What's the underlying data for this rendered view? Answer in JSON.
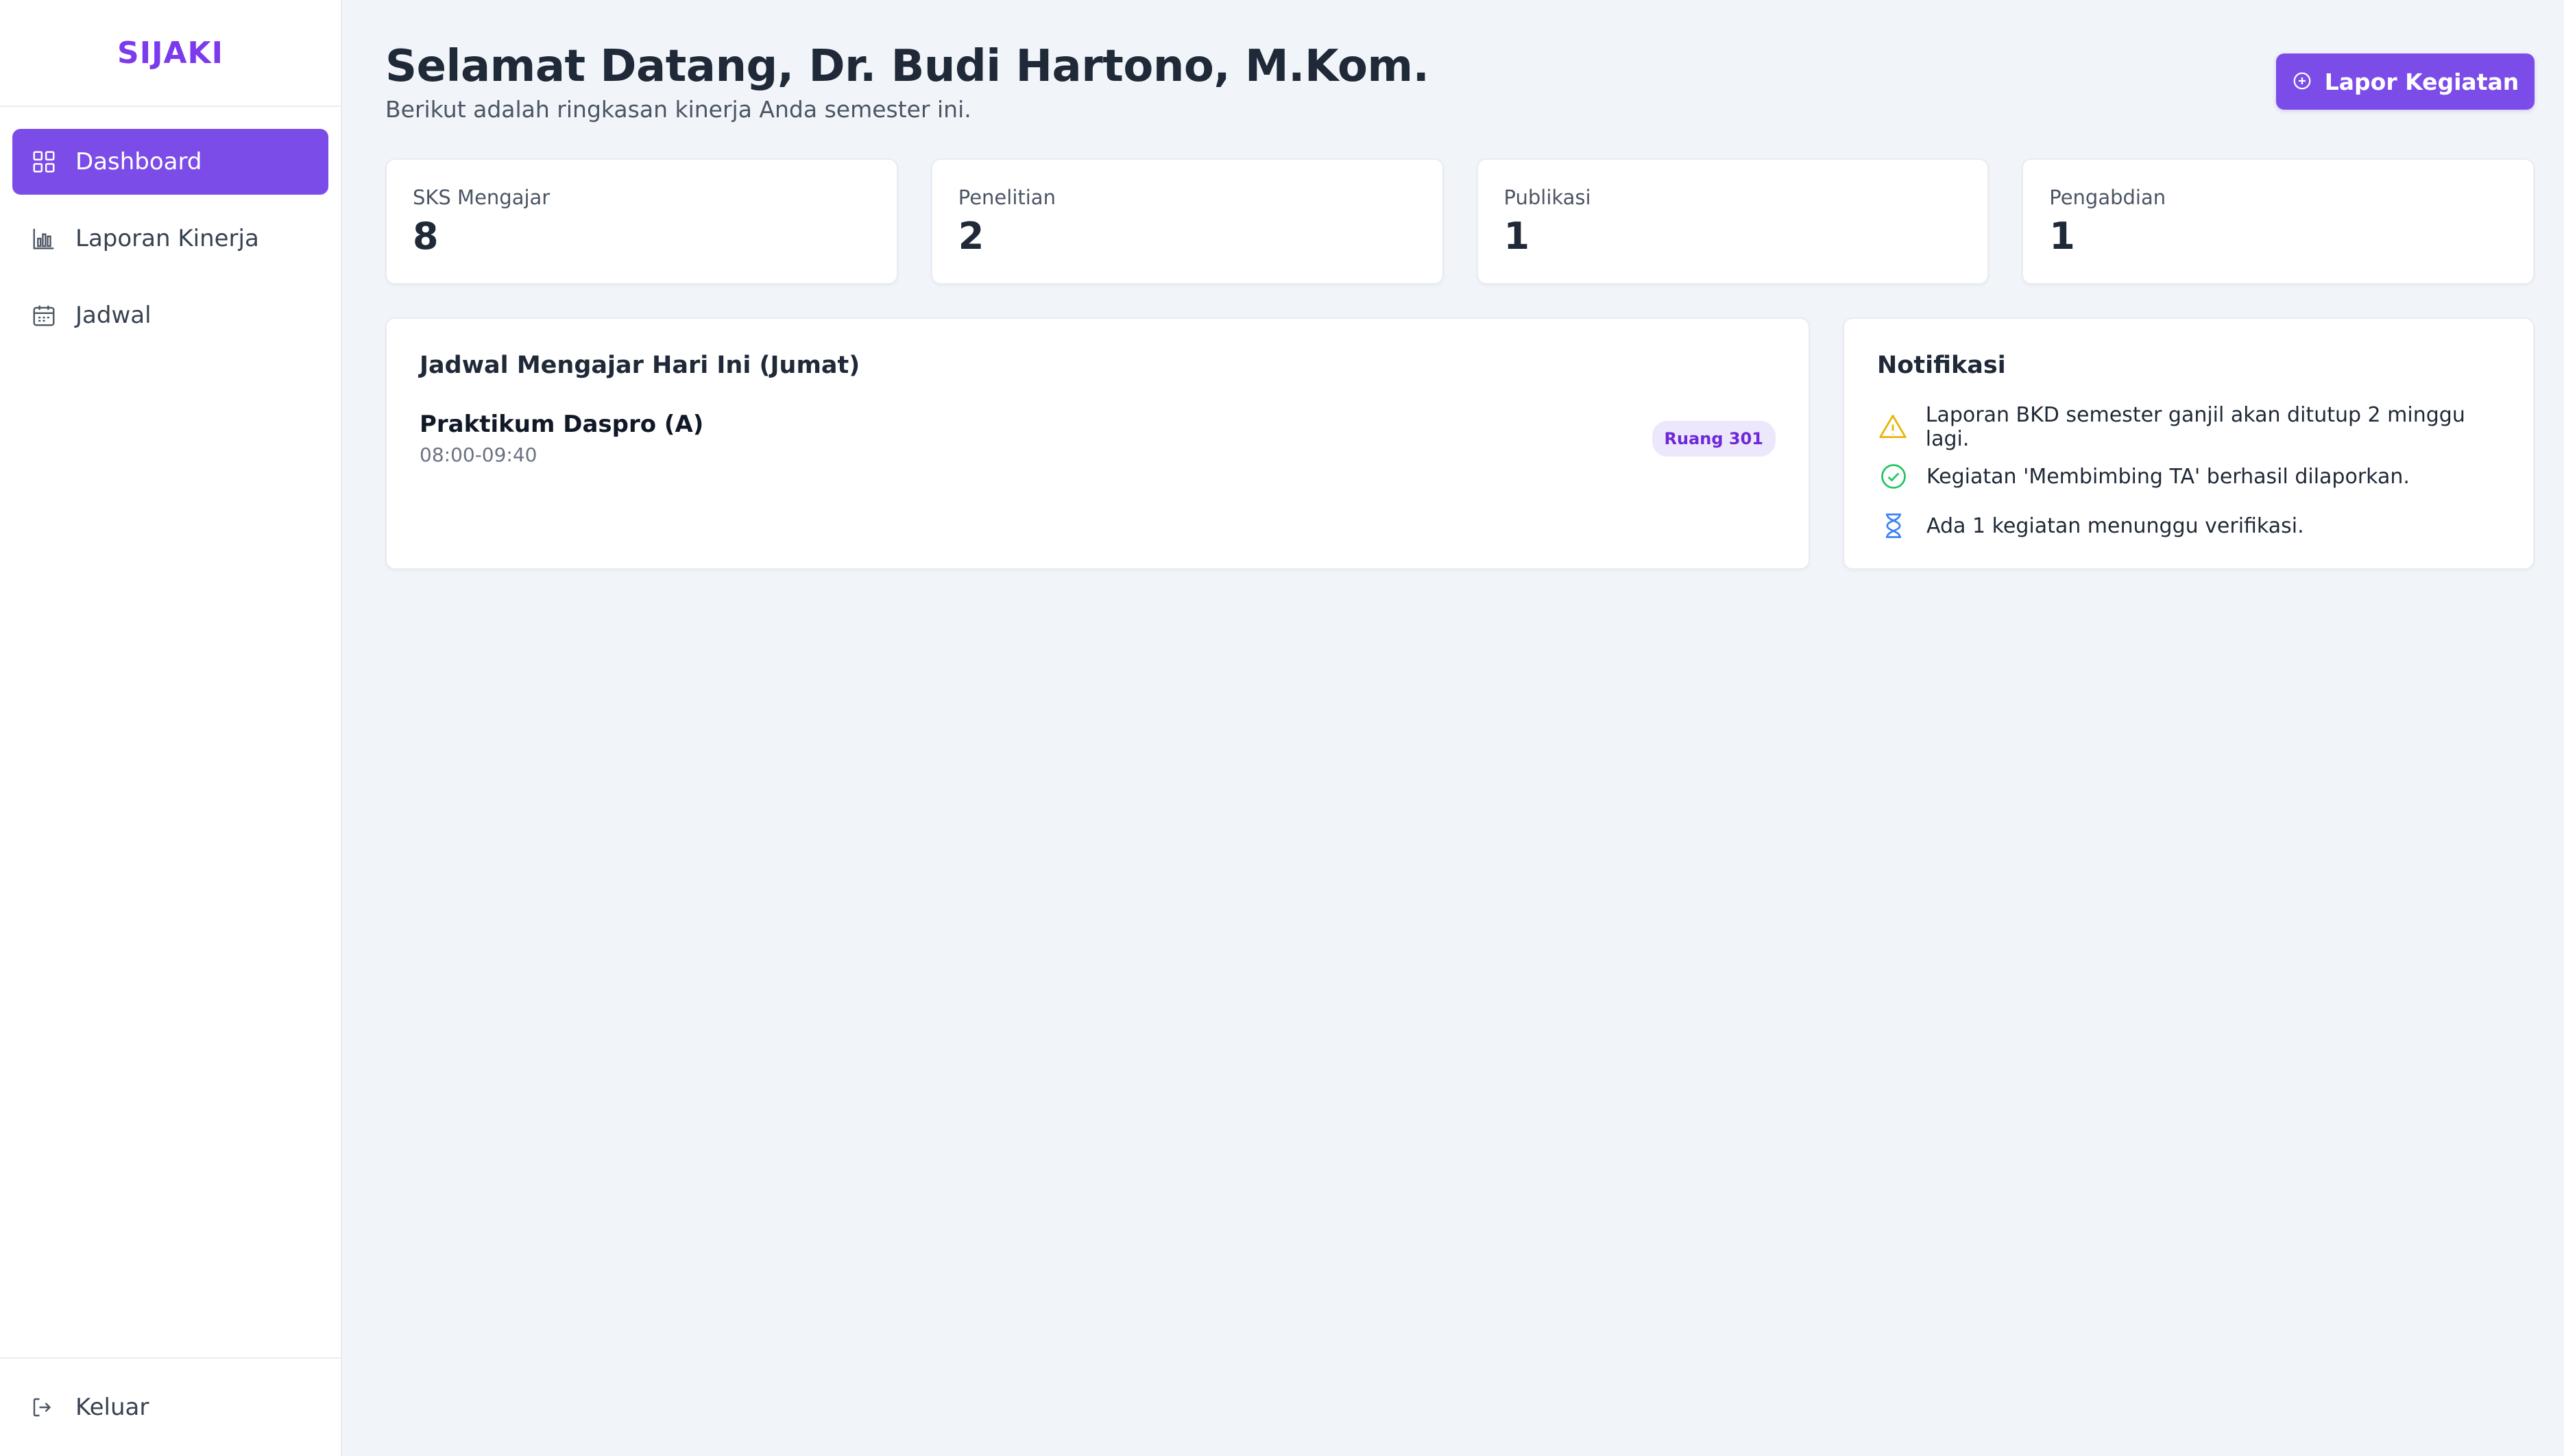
{
  "app": {
    "brand": "SIJAKI"
  },
  "sidebar": {
    "items": [
      {
        "label": "Dashboard",
        "icon": "grid-icon",
        "active": true
      },
      {
        "label": "Laporan Kinerja",
        "icon": "bar-chart-icon",
        "active": false
      },
      {
        "label": "Jadwal",
        "icon": "calendar-icon",
        "active": false
      }
    ],
    "logout_label": "Keluar"
  },
  "header": {
    "title": "Selamat Datang, Dr. Budi Hartono, M.Kom.",
    "subtitle": "Berikut adalah ringkasan kinerja Anda semester ini.",
    "report_button_label": "Lapor Kegiatan"
  },
  "stats": [
    {
      "label": "SKS Mengajar",
      "value": "8"
    },
    {
      "label": "Penelitian",
      "value": "2"
    },
    {
      "label": "Publikasi",
      "value": "1"
    },
    {
      "label": "Pengabdian",
      "value": "1"
    }
  ],
  "schedule": {
    "title": "Jadwal Mengajar Hari Ini (Jumat)",
    "items": [
      {
        "name": "Praktikum Daspro (A)",
        "time": "08:00-09:40",
        "room": "Ruang 301"
      }
    ]
  },
  "notifications": {
    "title": "Notifikasi",
    "items": [
      {
        "text": "Laporan BKD semester ganjil akan ditutup 2 minggu lagi.",
        "icon": "warning-icon",
        "color": "#eab308"
      },
      {
        "text": "Kegiatan 'Membimbing TA' berhasil dilaporkan.",
        "icon": "check-circle-icon",
        "color": "#22c55e"
      },
      {
        "text": "Ada 1 kegiatan menunggu verifikasi.",
        "icon": "hourglass-icon",
        "color": "#3b82f6"
      }
    ]
  },
  "colors": {
    "accent": "#7c4ce8",
    "brand": "#7c3aed",
    "background": "#f1f4f9"
  }
}
